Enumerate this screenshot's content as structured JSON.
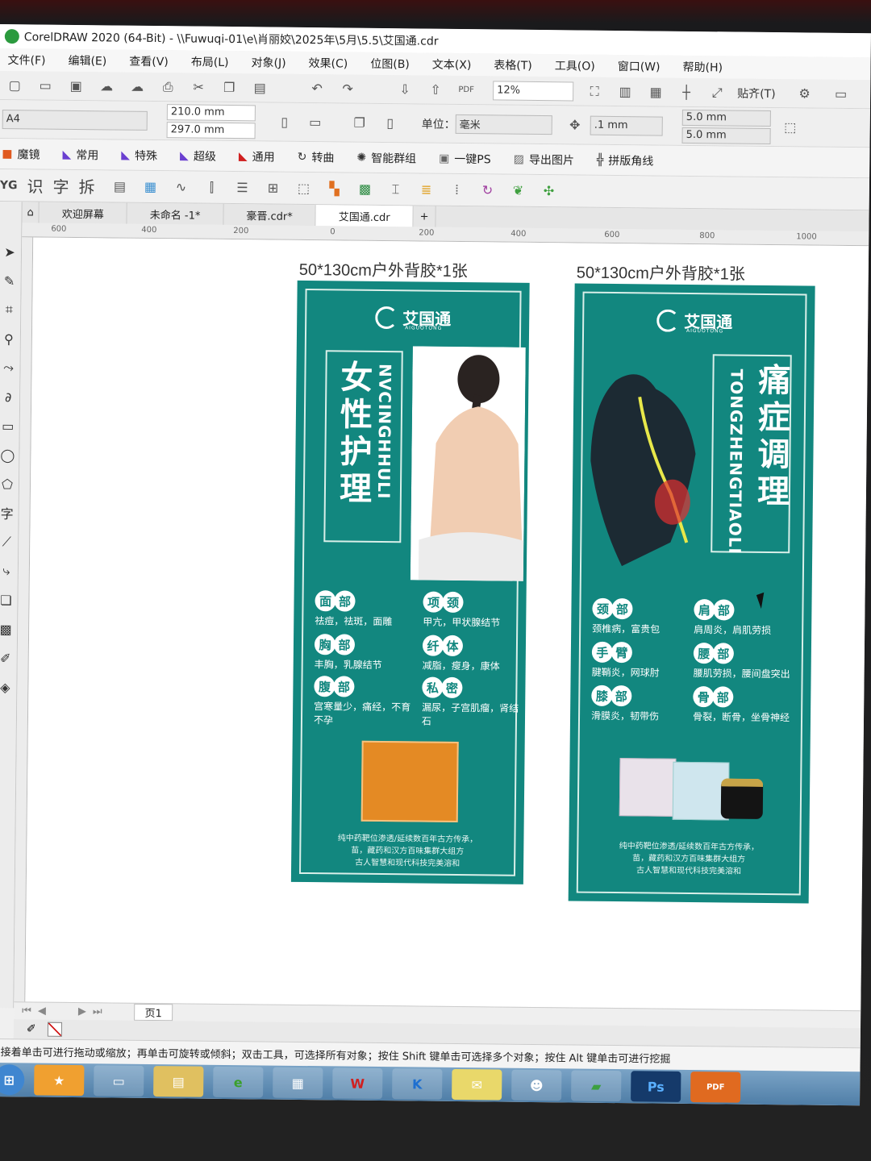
{
  "window": {
    "title": "CorelDRAW 2020 (64-Bit) - \\\\Fuwuqi-01\\e\\肖丽姣\\2025年\\5月\\5.5\\艾国通.cdr"
  },
  "menu": [
    "文件(F)",
    "编辑(E)",
    "查看(V)",
    "布局(L)",
    "对象(J)",
    "效果(C)",
    "位图(B)",
    "文本(X)",
    "表格(T)",
    "工具(O)",
    "窗口(W)",
    "帮助(H)"
  ],
  "toolbar": {
    "zoom": "12%",
    "snap": "贴齐(T)",
    "page_size": "A4",
    "width": "210.0 mm",
    "height": "297.0 mm",
    "unit_label": "单位：",
    "unit": "毫米",
    "nudge": ".1 mm",
    "dup_x": "5.0 mm",
    "dup_y": "5.0 mm"
  },
  "plugins": [
    "魔镜",
    "常用",
    "特殊",
    "超级",
    "通用",
    "转曲",
    "智能群组",
    "一键PS",
    "导出图片",
    "拼版角线"
  ],
  "plugin_row2": [
    "识",
    "字",
    "拆"
  ],
  "tabs": [
    "欢迎屏幕",
    "未命名 -1*",
    "豪晋.cdr*",
    "艾国通.cdr"
  ],
  "ruler": [
    "600",
    "400",
    "200",
    "0",
    "200",
    "400",
    "600",
    "800",
    "1000"
  ],
  "banners": [
    {
      "caption": "50*130cm户外背胶*1张",
      "brand": "艾国通",
      "brand_sub": "AIGUOTONG",
      "title_cn": "女性护理",
      "title_en": "NVCINGHHULI",
      "tags": [
        {
          "name": [
            "面",
            "部"
          ],
          "desc": "祛痘，祛斑，面雕"
        },
        {
          "name": [
            "项",
            "颈"
          ],
          "desc": "甲亢，甲状腺结节"
        },
        {
          "name": [
            "胸",
            "部"
          ],
          "desc": "丰胸，乳腺结节"
        },
        {
          "name": [
            "纤",
            "体"
          ],
          "desc": "减脂，瘦身，康体"
        },
        {
          "name": [
            "腹",
            "部"
          ],
          "desc": "宫寒量少，痛经，不育不孕"
        },
        {
          "name": [
            "私",
            "密"
          ],
          "desc": "漏尿，子宫肌瘤，肾结石"
        }
      ],
      "foot": [
        "纯中药靶位渗透/延续数百年古方传承，",
        "苗，藏药和汉方百味集群大组方",
        "古人智慧和现代科技完美溶和"
      ]
    },
    {
      "caption": "50*130cm户外背胶*1张",
      "brand": "艾国通",
      "brand_sub": "AIGUOTONG",
      "title_cn": "痛症调理",
      "title_en": "TONGZHENGTIAOLI",
      "tags": [
        {
          "name": [
            "颈",
            "部"
          ],
          "desc": "颈椎病，富贵包"
        },
        {
          "name": [
            "肩",
            "部"
          ],
          "desc": "肩周炎，肩肌劳损"
        },
        {
          "name": [
            "手",
            "臂"
          ],
          "desc": "腱鞘炎，网球肘"
        },
        {
          "name": [
            "腰",
            "部"
          ],
          "desc": "腰肌劳损，腰间盘突出"
        },
        {
          "name": [
            "膝",
            "部"
          ],
          "desc": "滑膜炎，韧带伤"
        },
        {
          "name": [
            "骨",
            "部"
          ],
          "desc": "骨裂，断骨，坐骨神经"
        }
      ],
      "foot": [
        "纯中药靶位渗透/延续数百年古方传承，",
        "苗，藏药和汉方百味集群大组方",
        "古人智慧和现代科技完美溶和"
      ]
    }
  ],
  "pagebar": {
    "page": "页1"
  },
  "status": "接着单击可进行拖动或缩放；再单击可旋转或倾斜；双击工具，可选择所有对象；按住 Shift 键单击可选择多个对象；按住 Alt 键单击可进行挖掘",
  "taskbar": [
    "",
    "W",
    "K",
    "",
    "",
    "",
    "Ps",
    "PDF"
  ]
}
